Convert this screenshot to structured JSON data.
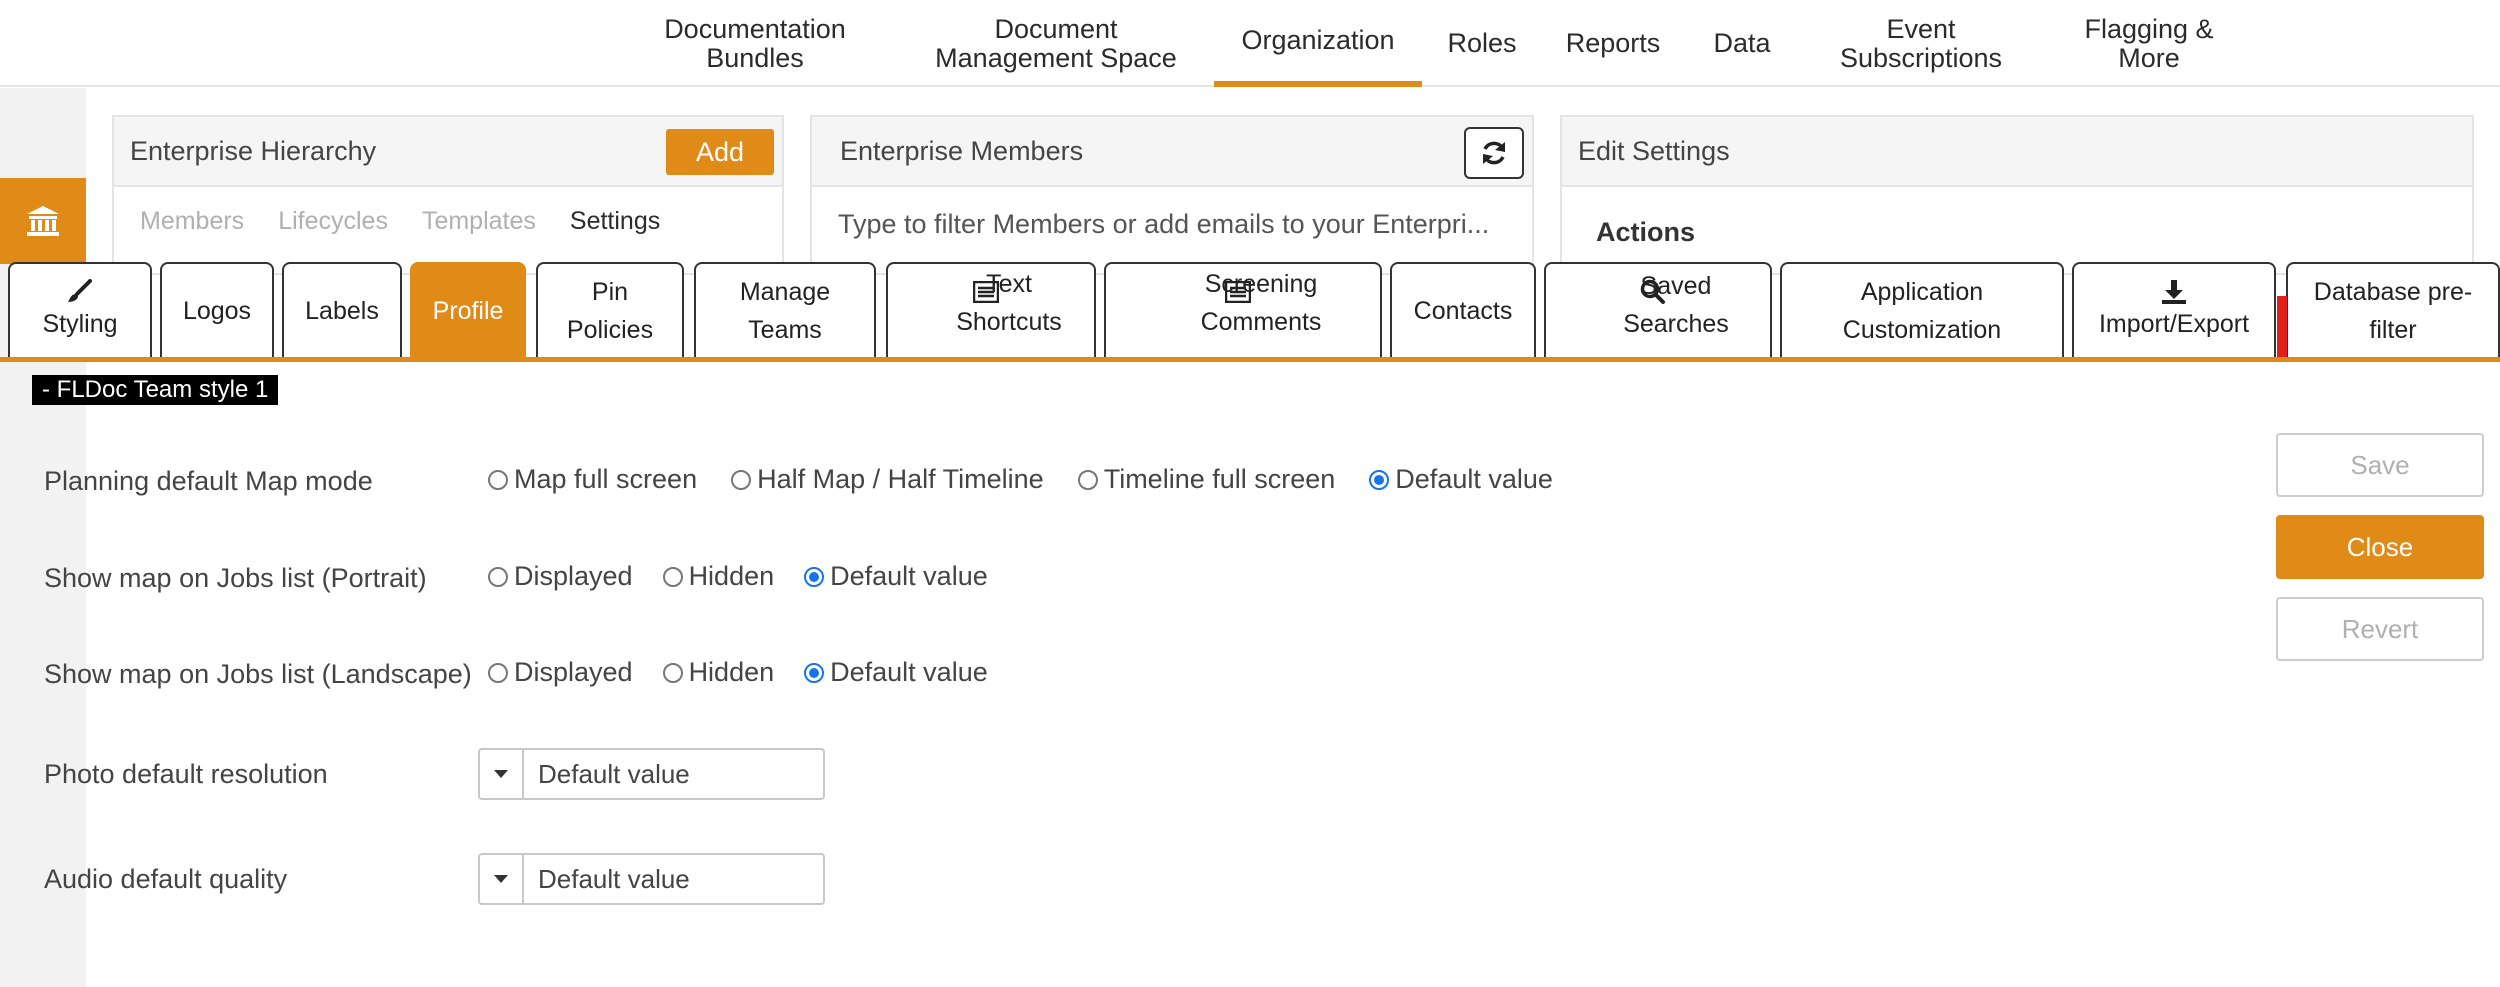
{
  "nav": {
    "items": [
      {
        "label": "Documentation\nBundles"
      },
      {
        "label": "Document\nManagement Space"
      },
      {
        "label": "Organization"
      },
      {
        "label": "Roles"
      },
      {
        "label": "Reports"
      },
      {
        "label": "Data"
      },
      {
        "label": "Event\nSubscriptions"
      },
      {
        "label": "Flagging &\nMore"
      }
    ],
    "active": "Organization"
  },
  "background": {
    "hierarchy": {
      "title": "Enterprise Hierarchy",
      "add_label": "Add",
      "subtabs": [
        "Members",
        "Lifecycles",
        "Templates",
        "Settings"
      ]
    },
    "members": {
      "title": "Enterprise Members",
      "filter_text": "Type to filter Members or add emails to your Enterpri..."
    },
    "settings": {
      "title": "Edit Settings",
      "actions_label": "Actions"
    },
    "sidebar_icon": "bank-icon"
  },
  "tabs": [
    {
      "label": "Styling",
      "icon": "brush-icon"
    },
    {
      "label": "Logos"
    },
    {
      "label": "Labels"
    },
    {
      "label": "Profile",
      "active": true
    },
    {
      "label": "Pin\nPolicies"
    },
    {
      "label": "Manage\nTeams"
    },
    {
      "label": "Text\nShortcuts",
      "icon": "list-icon"
    },
    {
      "label": "Screening\nComments",
      "icon": "list-icon"
    },
    {
      "label": "Contacts"
    },
    {
      "label": "Saved\nSearches",
      "icon": "search-icon"
    },
    {
      "label": "Application\nCustomization"
    },
    {
      "label": "Import/Export",
      "icon": "download-icon"
    },
    {
      "label": "Database pre-\nfilter"
    }
  ],
  "profile": {
    "style_name": "- FLDoc Team style 1",
    "rows": [
      {
        "label": "Planning default Map mode",
        "options": [
          "Map full screen",
          "Half Map / Half Timeline",
          "Timeline full screen",
          "Default value"
        ],
        "selected": "Default value"
      },
      {
        "label": "Show map on Jobs list (Portrait)",
        "options": [
          "Displayed",
          "Hidden",
          "Default value"
        ],
        "selected": "Default value"
      },
      {
        "label": "Show map on Jobs list (Landscape)",
        "options": [
          "Displayed",
          "Hidden",
          "Default value"
        ],
        "selected": "Default value"
      }
    ],
    "selects": [
      {
        "label": "Photo default resolution",
        "value": "Default value"
      },
      {
        "label": "Audio default quality",
        "value": "Default value"
      }
    ],
    "buttons": {
      "save": "Save",
      "close": "Close",
      "revert": "Revert"
    }
  },
  "colors": {
    "accent": "#e08a17",
    "radio_selected": "#1a73e8",
    "flag": "#e0201a"
  }
}
